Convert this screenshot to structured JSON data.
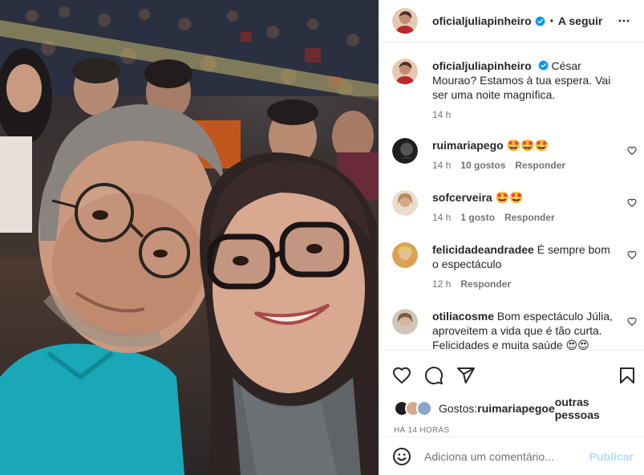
{
  "post": {
    "photo_icon": "selfie-photo"
  },
  "header": {
    "username": "oficialjuliapinheiro",
    "verified_icon": "verified-badge-icon",
    "separator": "•",
    "follow_label": "A seguir",
    "more_icon": "more-horizontal-icon"
  },
  "caption": {
    "username": "oficialjuliapinheiro",
    "text": "César Mourao? Estamos à tua espera. Vai ser uma noite magnífica.",
    "time": "14 h"
  },
  "comments": [
    {
      "username": "ruimariapego",
      "text": "🤩🤩🤩",
      "time": "14 h",
      "likes": "10 gostos",
      "reply": "Responder"
    },
    {
      "username": "sofcerveira",
      "text": "🤩🤩",
      "time": "14 h",
      "likes": "1 gosto",
      "reply": "Responder"
    },
    {
      "username": "felicidadeandradee",
      "text": "É sempre bom o espectáculo",
      "time": "12 h",
      "likes": "",
      "reply": "Responder"
    },
    {
      "username": "otiliacosme",
      "text": "Bom espectáculo Júlia, aproveitem a vida que é tão curta. Felicidades e muita saúde 😍😍",
      "time": "",
      "likes": "",
      "reply": ""
    }
  ],
  "actions": {
    "like_icon": "heart-icon",
    "comment_icon": "comment-icon",
    "share_icon": "paper-plane-icon",
    "save_icon": "bookmark-icon"
  },
  "likes": {
    "prefix": "Gostos: ",
    "user": "ruimariapego",
    "connector": " e ",
    "others": "outras pessoas"
  },
  "time_ago": "HÁ 14 HORAS",
  "add_comment": {
    "placeholder": "Adiciona um comentário...",
    "post_label": "Publicar",
    "emoji_icon": "smiley-icon"
  },
  "colors": {
    "verified": "#0095f6",
    "publish_disabled": "#b3dbff",
    "secondary_text": "#737373"
  }
}
